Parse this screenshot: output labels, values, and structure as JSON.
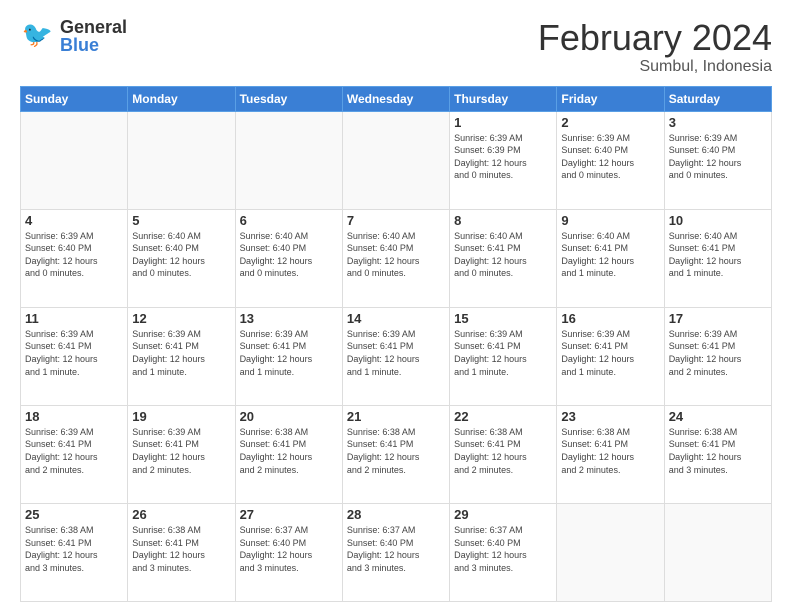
{
  "header": {
    "logo_general": "General",
    "logo_blue": "Blue",
    "month_title": "February 2024",
    "location": "Sumbul, Indonesia"
  },
  "days_of_week": [
    "Sunday",
    "Monday",
    "Tuesday",
    "Wednesday",
    "Thursday",
    "Friday",
    "Saturday"
  ],
  "weeks": [
    [
      {
        "day": "",
        "info": ""
      },
      {
        "day": "",
        "info": ""
      },
      {
        "day": "",
        "info": ""
      },
      {
        "day": "",
        "info": ""
      },
      {
        "day": "1",
        "info": "Sunrise: 6:39 AM\nSunset: 6:39 PM\nDaylight: 12 hours\nand 0 minutes."
      },
      {
        "day": "2",
        "info": "Sunrise: 6:39 AM\nSunset: 6:40 PM\nDaylight: 12 hours\nand 0 minutes."
      },
      {
        "day": "3",
        "info": "Sunrise: 6:39 AM\nSunset: 6:40 PM\nDaylight: 12 hours\nand 0 minutes."
      }
    ],
    [
      {
        "day": "4",
        "info": "Sunrise: 6:39 AM\nSunset: 6:40 PM\nDaylight: 12 hours\nand 0 minutes."
      },
      {
        "day": "5",
        "info": "Sunrise: 6:40 AM\nSunset: 6:40 PM\nDaylight: 12 hours\nand 0 minutes."
      },
      {
        "day": "6",
        "info": "Sunrise: 6:40 AM\nSunset: 6:40 PM\nDaylight: 12 hours\nand 0 minutes."
      },
      {
        "day": "7",
        "info": "Sunrise: 6:40 AM\nSunset: 6:40 PM\nDaylight: 12 hours\nand 0 minutes."
      },
      {
        "day": "8",
        "info": "Sunrise: 6:40 AM\nSunset: 6:41 PM\nDaylight: 12 hours\nand 0 minutes."
      },
      {
        "day": "9",
        "info": "Sunrise: 6:40 AM\nSunset: 6:41 PM\nDaylight: 12 hours\nand 1 minute."
      },
      {
        "day": "10",
        "info": "Sunrise: 6:40 AM\nSunset: 6:41 PM\nDaylight: 12 hours\nand 1 minute."
      }
    ],
    [
      {
        "day": "11",
        "info": "Sunrise: 6:39 AM\nSunset: 6:41 PM\nDaylight: 12 hours\nand 1 minute."
      },
      {
        "day": "12",
        "info": "Sunrise: 6:39 AM\nSunset: 6:41 PM\nDaylight: 12 hours\nand 1 minute."
      },
      {
        "day": "13",
        "info": "Sunrise: 6:39 AM\nSunset: 6:41 PM\nDaylight: 12 hours\nand 1 minute."
      },
      {
        "day": "14",
        "info": "Sunrise: 6:39 AM\nSunset: 6:41 PM\nDaylight: 12 hours\nand 1 minute."
      },
      {
        "day": "15",
        "info": "Sunrise: 6:39 AM\nSunset: 6:41 PM\nDaylight: 12 hours\nand 1 minute."
      },
      {
        "day": "16",
        "info": "Sunrise: 6:39 AM\nSunset: 6:41 PM\nDaylight: 12 hours\nand 1 minute."
      },
      {
        "day": "17",
        "info": "Sunrise: 6:39 AM\nSunset: 6:41 PM\nDaylight: 12 hours\nand 2 minutes."
      }
    ],
    [
      {
        "day": "18",
        "info": "Sunrise: 6:39 AM\nSunset: 6:41 PM\nDaylight: 12 hours\nand 2 minutes."
      },
      {
        "day": "19",
        "info": "Sunrise: 6:39 AM\nSunset: 6:41 PM\nDaylight: 12 hours\nand 2 minutes."
      },
      {
        "day": "20",
        "info": "Sunrise: 6:38 AM\nSunset: 6:41 PM\nDaylight: 12 hours\nand 2 minutes."
      },
      {
        "day": "21",
        "info": "Sunrise: 6:38 AM\nSunset: 6:41 PM\nDaylight: 12 hours\nand 2 minutes."
      },
      {
        "day": "22",
        "info": "Sunrise: 6:38 AM\nSunset: 6:41 PM\nDaylight: 12 hours\nand 2 minutes."
      },
      {
        "day": "23",
        "info": "Sunrise: 6:38 AM\nSunset: 6:41 PM\nDaylight: 12 hours\nand 2 minutes."
      },
      {
        "day": "24",
        "info": "Sunrise: 6:38 AM\nSunset: 6:41 PM\nDaylight: 12 hours\nand 3 minutes."
      }
    ],
    [
      {
        "day": "25",
        "info": "Sunrise: 6:38 AM\nSunset: 6:41 PM\nDaylight: 12 hours\nand 3 minutes."
      },
      {
        "day": "26",
        "info": "Sunrise: 6:38 AM\nSunset: 6:41 PM\nDaylight: 12 hours\nand 3 minutes."
      },
      {
        "day": "27",
        "info": "Sunrise: 6:37 AM\nSunset: 6:40 PM\nDaylight: 12 hours\nand 3 minutes."
      },
      {
        "day": "28",
        "info": "Sunrise: 6:37 AM\nSunset: 6:40 PM\nDaylight: 12 hours\nand 3 minutes."
      },
      {
        "day": "29",
        "info": "Sunrise: 6:37 AM\nSunset: 6:40 PM\nDaylight: 12 hours\nand 3 minutes."
      },
      {
        "day": "",
        "info": ""
      },
      {
        "day": "",
        "info": ""
      }
    ]
  ]
}
